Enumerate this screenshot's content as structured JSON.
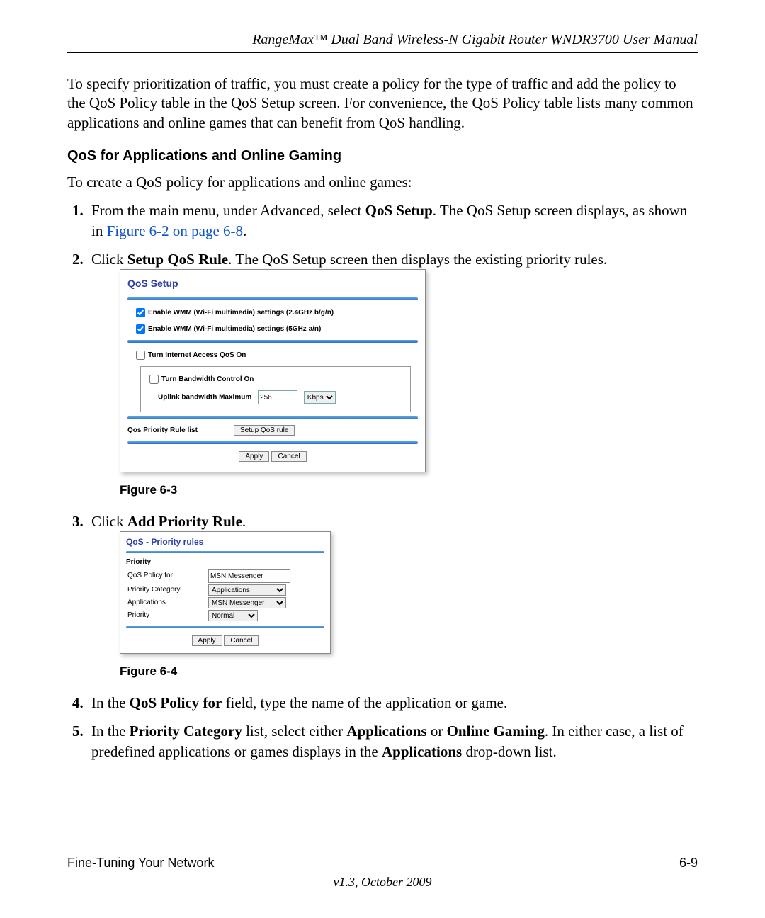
{
  "header": "RangeMax™ Dual Band Wireless-N Gigabit Router WNDR3700 User Manual",
  "intro": "To specify prioritization of traffic, you must create a policy for the type of traffic and add the policy to the QoS Policy table in the QoS Setup screen. For convenience, the QoS Policy table lists many common applications and online games that can benefit from QoS handling.",
  "section_head": "QoS for Applications and Online Gaming",
  "lead": "To create a QoS policy for applications and online games:",
  "step1_a": "From the main menu, under Advanced, select ",
  "step1_b": "QoS Setup",
  "step1_c": ". The QoS Setup screen displays, as shown in ",
  "step1_link": "Figure 6-2 on page 6-8",
  "step1_d": ".",
  "step2_a": "Click ",
  "step2_b": "Setup QoS Rule",
  "step2_c": ". The QoS Setup screen then displays the existing priority rules.",
  "fig63": "Figure 6-3",
  "step3_a": "Click ",
  "step3_b": "Add Priority Rule",
  "step3_c": ".",
  "fig64": "Figure 6-4",
  "step4_a": "In the ",
  "step4_b": "QoS Policy for",
  "step4_c": " field, type the name of the application or game.",
  "step5_a": "In the ",
  "step5_b": "Priority Category",
  "step5_c": " list, select either ",
  "step5_d": "Applications",
  "step5_e": " or ",
  "step5_f": "Online Gaming",
  "step5_g": ". In either case, a list of predefined applications or games displays in the ",
  "step5_h": "Applications",
  "step5_i": " drop-down list.",
  "qos": {
    "title": "QoS Setup",
    "wmm24": "Enable WMM (Wi-Fi multimedia) settings (2.4GHz b/g/n)",
    "wmm5": "Enable WMM (Wi-Fi multimedia) settings (5GHz a/n)",
    "turn_qos": "Turn Internet Access QoS On",
    "turn_bw": "Turn Bandwidth Control On",
    "uplink_label": "Uplink bandwidth   Maximum",
    "uplink_val": "256",
    "uplink_unit": "Kbps",
    "rule_list": "Qos Priority Rule list",
    "setup_btn": "Setup QoS rule",
    "apply": "Apply",
    "cancel": "Cancel"
  },
  "prio": {
    "title": "QoS - Priority rules",
    "heading": "Priority",
    "row1_label": "QoS Policy for",
    "row1_val": "MSN Messenger",
    "row2_label": "Priority Category",
    "row2_val": "Applications",
    "row3_label": "Applications",
    "row3_val": "MSN Messenger",
    "row4_label": "Priority",
    "row4_val": "Normal",
    "apply": "Apply",
    "cancel": "Cancel"
  },
  "footer": {
    "left": "Fine-Tuning Your Network",
    "right": "6-9",
    "version": "v1.3, October 2009"
  }
}
